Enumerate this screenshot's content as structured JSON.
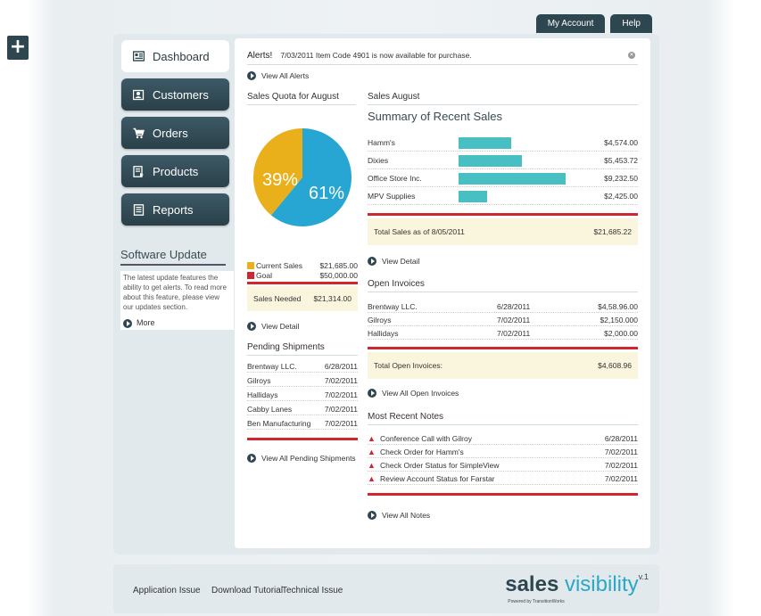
{
  "top_nav": {
    "account": "My Account",
    "help": "Help"
  },
  "plus": "+",
  "nav": [
    {
      "label": "Dashboard",
      "icon": "dashboard-icon"
    },
    {
      "label": "Customers",
      "icon": "customers-icon"
    },
    {
      "label": "Orders",
      "icon": "cart-icon"
    },
    {
      "label": "Products",
      "icon": "products-icon"
    },
    {
      "label": "Reports",
      "icon": "reports-icon"
    }
  ],
  "software_update": {
    "title": "Software Update",
    "body": "The latest update features the ability to get alerts. To read more about this feature, please view our updates section.",
    "more": "More"
  },
  "alert": {
    "label": "Alerts!",
    "message": "7/03/2011 Item Code 4901 is now available for purchase.",
    "view_all": "View All Alerts"
  },
  "quota": {
    "title": "Sales Quota for August",
    "pct_current": "39%",
    "pct_remaining": "61%",
    "current_label": "Current Sales",
    "current_value": "$21,685.00",
    "goal_label": "Goal",
    "goal_value": "$50,000.00",
    "needed_label": "Sales Needed",
    "needed_value": "$21,314.00",
    "view_detail": "View Detail",
    "colors": {
      "current": "#e9b01c",
      "remaining": "#27a6d3",
      "goal": "#d0262f"
    }
  },
  "pending": {
    "title": "Pending Shipments",
    "rows": [
      {
        "name": "Brentway LLC.",
        "date": "6/28/2011"
      },
      {
        "name": "Gilroys",
        "date": "7/02/2011"
      },
      {
        "name": "Hallidays",
        "date": "7/02/2011"
      },
      {
        "name": "Cabby Lanes",
        "date": "7/02/2011"
      },
      {
        "name": "Ben Manufacturing",
        "date": "7/02/2011"
      }
    ],
    "view_all": "View All Pending Shipments"
  },
  "sales": {
    "heading": "Sales August",
    "title": "Summary of Recent Sales",
    "rows": [
      {
        "name": "Hamm's",
        "value": "$4,574.00"
      },
      {
        "name": "Dixies",
        "value": "$5,453.72"
      },
      {
        "name": "Office Store Inc.",
        "value": "$9,232.50"
      },
      {
        "name": "MPV Supplies",
        "value": "$2,425.00"
      }
    ],
    "total_label": "Total Sales as of 8/05/2011",
    "total_value": "$21,685.22",
    "view_detail": "View Detail",
    "bar_color": "#48bfc3"
  },
  "invoices": {
    "title": "Open Invoices",
    "rows": [
      {
        "name": "Brentway LLC.",
        "date": "6/28/2011",
        "amount": "$4,58.96.00"
      },
      {
        "name": "Gilroys",
        "date": "7/02/2011",
        "amount": "$2,150.000"
      },
      {
        "name": "Hallidays",
        "date": "7/02/2011",
        "amount": "$2,000.00"
      }
    ],
    "total_label": "Total Open Invoices:",
    "total_value": "$4,608.96",
    "view_all": "View All Open Invoices"
  },
  "notes": {
    "title": "Most Recent Notes",
    "rows": [
      {
        "text": "Conference Call with Gilroy",
        "date": "6/28/2011"
      },
      {
        "text": "Check Order for Hamm's",
        "date": "7/02/2011"
      },
      {
        "text": "Check Order Status for SimpleView",
        "date": "7/02/2011"
      },
      {
        "text": "Review Account Status for Farstar",
        "date": "7/02/2011"
      }
    ],
    "view_all": "View All Notes"
  },
  "footer": {
    "links": [
      "Application Issue",
      "Download Tutorial",
      "Technical Issue"
    ],
    "brand_a": "sales",
    "brand_b": "visibility",
    "version": "v.1",
    "powered": "Powered by TransitionWorks"
  }
}
